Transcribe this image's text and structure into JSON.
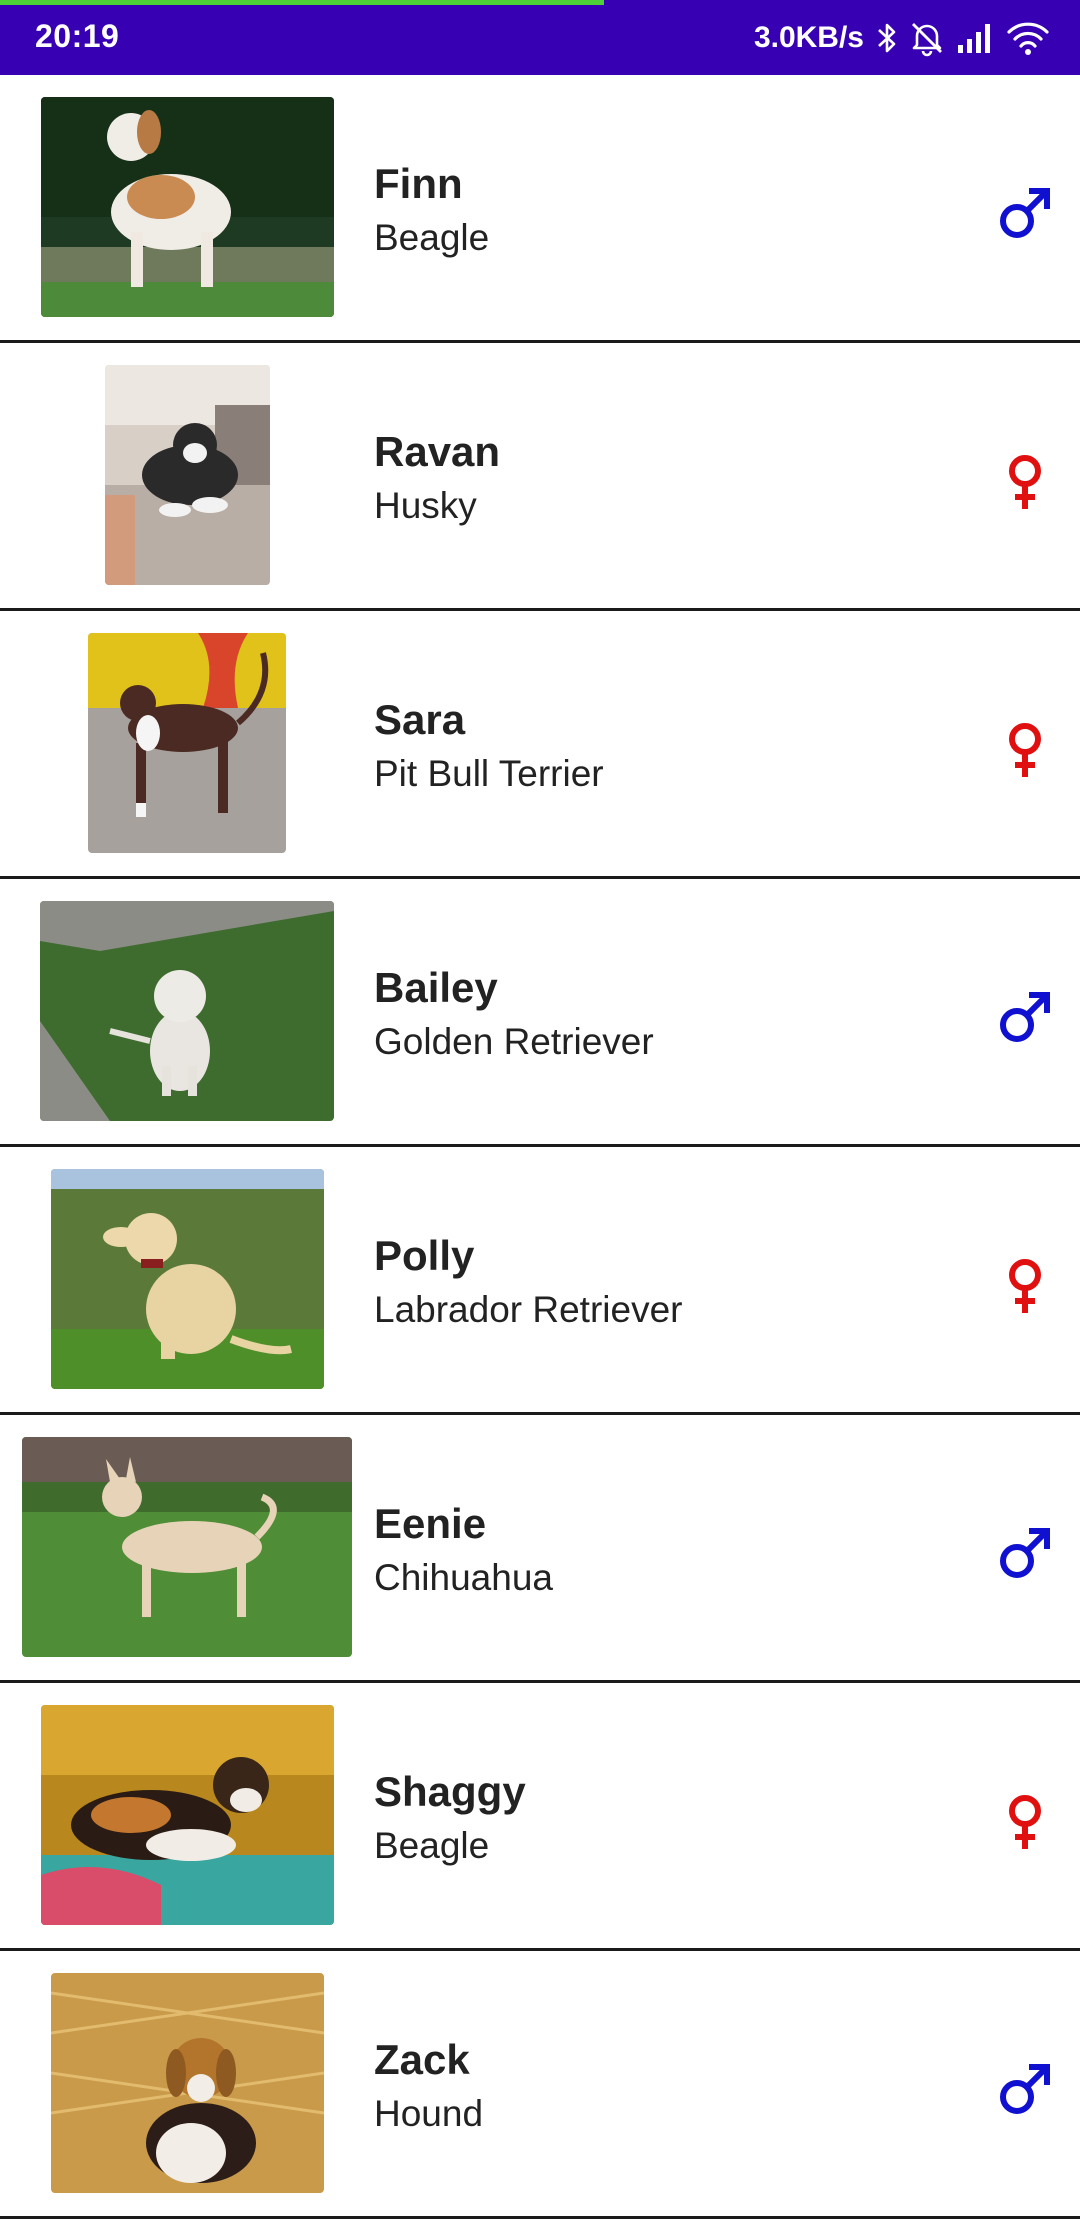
{
  "status_bar": {
    "time": "20:19",
    "net_speed": "3.0KB/s",
    "icons": [
      "bluetooth-icon",
      "alarm-off-icon",
      "signal-icon",
      "wifi-icon"
    ],
    "background": "#3700b3"
  },
  "dogs": [
    {
      "name": "Finn",
      "breed": "Beagle",
      "gender": "male"
    },
    {
      "name": "Ravan",
      "breed": "Husky",
      "gender": "female"
    },
    {
      "name": "Sara",
      "breed": "Pit Bull Terrier",
      "gender": "female"
    },
    {
      "name": "Bailey",
      "breed": "Golden Retriever",
      "gender": "male"
    },
    {
      "name": "Polly",
      "breed": "Labrador Retriever",
      "gender": "female"
    },
    {
      "name": "Eenie",
      "breed": "Chihuahua",
      "gender": "male"
    },
    {
      "name": "Shaggy",
      "breed": "Beagle",
      "gender": "female"
    },
    {
      "name": "Zack",
      "breed": "Hound",
      "gender": "male"
    }
  ],
  "colors": {
    "male": "#1010d0",
    "female": "#e01010",
    "divider": "#1a1a1a"
  }
}
